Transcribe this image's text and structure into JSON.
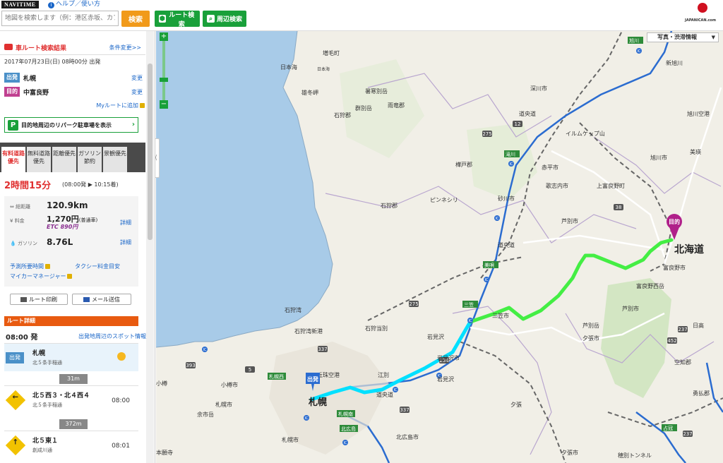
{
  "header": {
    "logo": "NAVITIME",
    "help": "ヘルプ／使い方",
    "search_placeholder": "地図を検索します（例：港区赤坂、カフ",
    "search_button": "検索",
    "route_button": "ルート検索",
    "nearby_button": "周辺検索",
    "ad_text": "JAPANICAN.com"
  },
  "sidebar": {
    "title": "車ルート検索結果",
    "change_conditions": "条件変更>>",
    "datetime": "2017年07月23日(日) 08時00分 出発",
    "origin_tag": "出発",
    "origin": "札幌",
    "dest_tag": "目的",
    "destination": "中富良野",
    "change": "変更",
    "myroute": "Myルートに追加",
    "parking": "目的地周辺のリパーク駐車場を表示",
    "tabs": [
      "有料道路優先",
      "無料道路優先",
      "距離優先",
      "ガソリン節約",
      "景観優先"
    ],
    "duration": "2時間15分",
    "duration_times": "(08:00発 ▶ 10:15着)",
    "stats": {
      "distance_label": "総距離",
      "distance": "120.9km",
      "fee_label": "料金",
      "fee": "1,270円",
      "fee_note": "(普通車)",
      "etc": "ETC 890円",
      "gas_label": "ガソリン",
      "gas": "8.76L",
      "detail": "詳細",
      "forecast": "予測所要時間",
      "taxi": "タクシー料金目安",
      "mycar": "マイカーマネージャー"
    },
    "print": "ルート印刷",
    "mail": "メール送信",
    "detail_header": "ルート詳細",
    "dep_time": "08:00 発",
    "spot_link": "出発地周辺のスポット情報",
    "steps": [
      {
        "badge": "出発",
        "name": "札幌",
        "sub": "北５条手稲通",
        "time": ""
      },
      {
        "name": "北５西３・北４西４",
        "sub": "北５条手稲通",
        "time": "08:00"
      },
      {
        "name": "北５東１",
        "sub": "創成川通",
        "time": "08:01"
      }
    ],
    "distances": [
      "31m",
      "372m"
    ]
  },
  "map": {
    "layer_label": "写真・渋滞情報",
    "labels": {
      "hokkaido": "北海道",
      "sapporo": "札幌",
      "dest_pin": "目的",
      "origin_pin": "出発",
      "nihonkai": "日本海",
      "asahikawa": "旭川",
      "ishikariwan": "石狩湾"
    },
    "place_names": [
      "増毛町",
      "雄冬岬",
      "暑寒別岳",
      "群別岳",
      "雨竜郡",
      "石狩郡",
      "樺戸郡",
      "ピンネシリ",
      "石狩郡",
      "深川市",
      "深川",
      "深川留萌道",
      "深川",
      "旭川市",
      "旭川空港",
      "イルムケップ山",
      "美瑛",
      "赤平市",
      "歌志内市",
      "上富良野町",
      "芦別市",
      "砂川市",
      "道央道",
      "美唄",
      "滝川",
      "中富良野",
      "富良野市",
      "富良野西岳",
      "三笠",
      "三笠市",
      "芦別岳",
      "夕張市",
      "石狩湾",
      "石狩湾新港",
      "石狩当別",
      "岩見沢",
      "岩見沢市",
      "江別",
      "丘珠空港",
      "札幌市",
      "小樽市",
      "小樽",
      "余市岳",
      "札幌南",
      "北広島",
      "北広島市",
      "夕張",
      "千歳市",
      "新夕張",
      "占冠",
      "穂別トンネル",
      "勇払郡",
      "空知郡",
      "新旭川",
      "北海道",
      "日高"
    ],
    "route_colors": {
      "expressway": "#00e0ff",
      "general": "#44ee44"
    },
    "road_numbers": [
      "275",
      "12",
      "337",
      "5",
      "231",
      "393",
      "234",
      "38",
      "237",
      "452",
      "274",
      "451",
      "233",
      "40",
      "39"
    ]
  }
}
